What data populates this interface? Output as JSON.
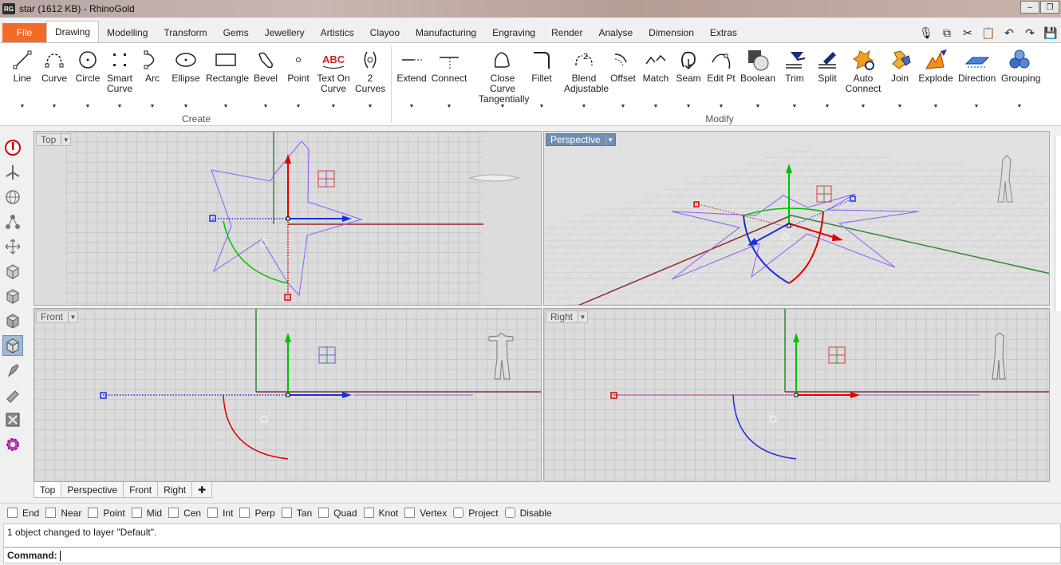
{
  "window": {
    "title": "star (1612 KB) - RhinoGold",
    "badge": "RG"
  },
  "tabs": {
    "file": "File",
    "items": [
      "Drawing",
      "Modelling",
      "Transform",
      "Gems",
      "Jewellery",
      "Artistics",
      "Clayoo",
      "Manufacturing",
      "Engraving",
      "Render",
      "Analyse",
      "Dimension",
      "Extras"
    ]
  },
  "ribbon": {
    "create_group": "Create",
    "modify_group": "Modify",
    "create": [
      {
        "l1": "Line",
        "l2": ""
      },
      {
        "l1": "Curve",
        "l2": ""
      },
      {
        "l1": "Circle",
        "l2": ""
      },
      {
        "l1": "Smart",
        "l2": "Curve"
      },
      {
        "l1": "Arc",
        "l2": ""
      },
      {
        "l1": "Ellipse",
        "l2": ""
      },
      {
        "l1": "Rectangle",
        "l2": ""
      },
      {
        "l1": "Bevel",
        "l2": ""
      },
      {
        "l1": "Point",
        "l2": ""
      },
      {
        "l1": "Text On",
        "l2": "Curve"
      },
      {
        "l1": "2",
        "l2": "Curves"
      }
    ],
    "modify": [
      {
        "l1": "Extend",
        "l2": ""
      },
      {
        "l1": "Connect",
        "l2": ""
      },
      {
        "l1": "Close Curve",
        "l2": "Tangentially"
      },
      {
        "l1": "Fillet",
        "l2": ""
      },
      {
        "l1": "Blend",
        "l2": "Adjustable"
      },
      {
        "l1": "Offset",
        "l2": ""
      },
      {
        "l1": "Match",
        "l2": ""
      },
      {
        "l1": "Seam",
        "l2": ""
      },
      {
        "l1": "Edit Pt",
        "l2": ""
      },
      {
        "l1": "Boolean",
        "l2": ""
      },
      {
        "l1": "Trim",
        "l2": ""
      },
      {
        "l1": "Split",
        "l2": ""
      },
      {
        "l1": "Auto",
        "l2": "Connect"
      },
      {
        "l1": "Join",
        "l2": ""
      },
      {
        "l1": "Explode",
        "l2": ""
      },
      {
        "l1": "Direction",
        "l2": ""
      },
      {
        "l1": "Grouping",
        "l2": ""
      }
    ],
    "textcurve_icon": "ABC",
    "blend_icon": "2"
  },
  "viewports": {
    "top": "Top",
    "perspective": "Perspective",
    "front": "Front",
    "right": "Right"
  },
  "viewport_tabs": [
    "Top",
    "Perspective",
    "Front",
    "Right"
  ],
  "osnap": [
    "End",
    "Near",
    "Point",
    "Mid",
    "Cen",
    "Int",
    "Perp",
    "Tan",
    "Quad",
    "Knot",
    "Vertex",
    "Project",
    "Disable"
  ],
  "command": {
    "history": "1 object changed to layer \"Default\".",
    "prompt": "Command:"
  },
  "colors": {
    "accent": "#f26b2a",
    "star": "#8b5cf6",
    "x_axis": "#8b2c2c",
    "y_axis": "#2f8a2f"
  }
}
